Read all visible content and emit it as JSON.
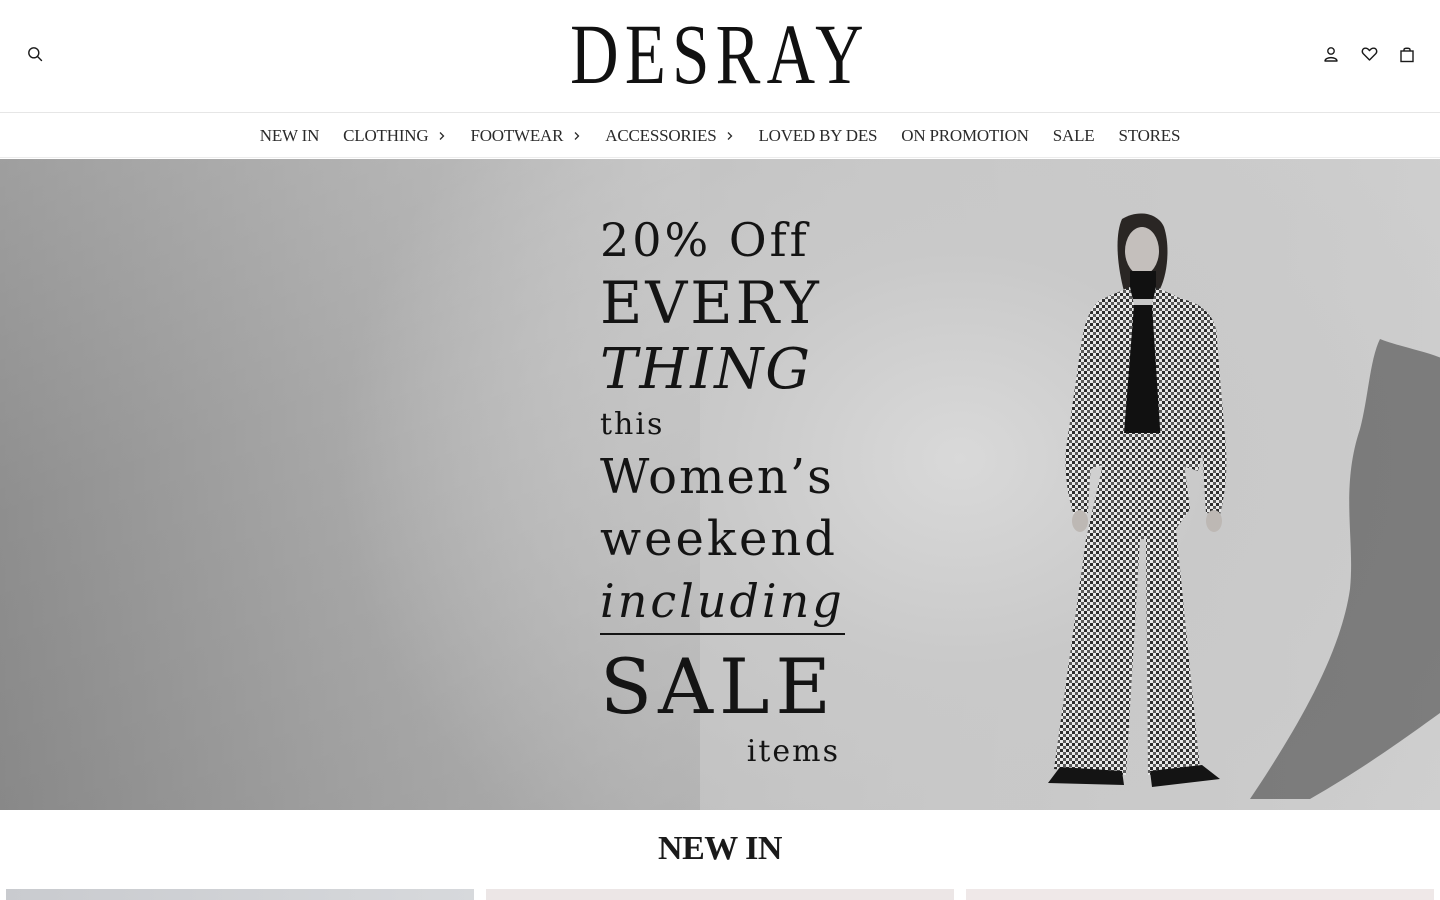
{
  "brand": {
    "logo": "DESRAY"
  },
  "header": {
    "search_icon": "search-icon",
    "account_icon": "account-icon",
    "wishlist_icon": "heart-icon",
    "bag_icon": "bag-icon"
  },
  "nav": {
    "items": [
      {
        "label": "NEW IN",
        "has_submenu": false
      },
      {
        "label": "CLOTHING",
        "has_submenu": true
      },
      {
        "label": "FOOTWEAR",
        "has_submenu": true
      },
      {
        "label": "ACCESSORIES",
        "has_submenu": true
      },
      {
        "label": "LOVED BY DES",
        "has_submenu": false
      },
      {
        "label": "ON PROMOTION",
        "has_submenu": false
      },
      {
        "label": "SALE",
        "has_submenu": false
      },
      {
        "label": "STORES",
        "has_submenu": false
      }
    ]
  },
  "hero": {
    "line1": "20% Off",
    "line2": "EVERY",
    "line3": "THING",
    "line4": "this",
    "line5": "Women’s",
    "line6": "weekend",
    "line7": "including",
    "line8": "SALE",
    "line9": "items"
  },
  "new_in": {
    "title": "NEW IN"
  }
}
